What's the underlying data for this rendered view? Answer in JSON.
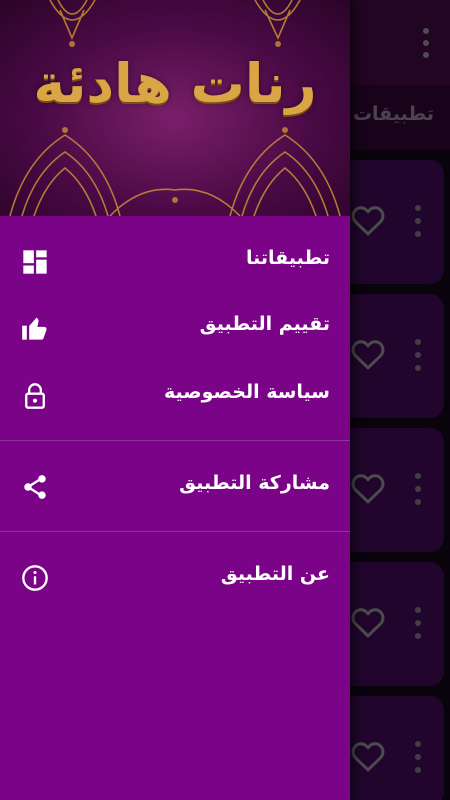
{
  "background_app": {
    "tab_label": "تطبيقات ا",
    "card_count": 5
  },
  "drawer": {
    "header_title": "رنات هادئة",
    "items": [
      {
        "label": "تطبيقاتنا",
        "icon": "dashboard-icon"
      },
      {
        "label": "تقييم التطبيق",
        "icon": "thumbs-up-icon"
      },
      {
        "label": "سياسة الخصوصية",
        "icon": "lock-icon"
      },
      {
        "label": "مشاركة التطبيق",
        "icon": "share-icon"
      },
      {
        "label": "عن التطبيق",
        "icon": "info-icon"
      }
    ]
  },
  "colors": {
    "drawer_background": "#7b0388",
    "header_text_gold": "#d9a545",
    "app_toolbar": "#3d0a41",
    "card_background": "#3d0a50"
  }
}
